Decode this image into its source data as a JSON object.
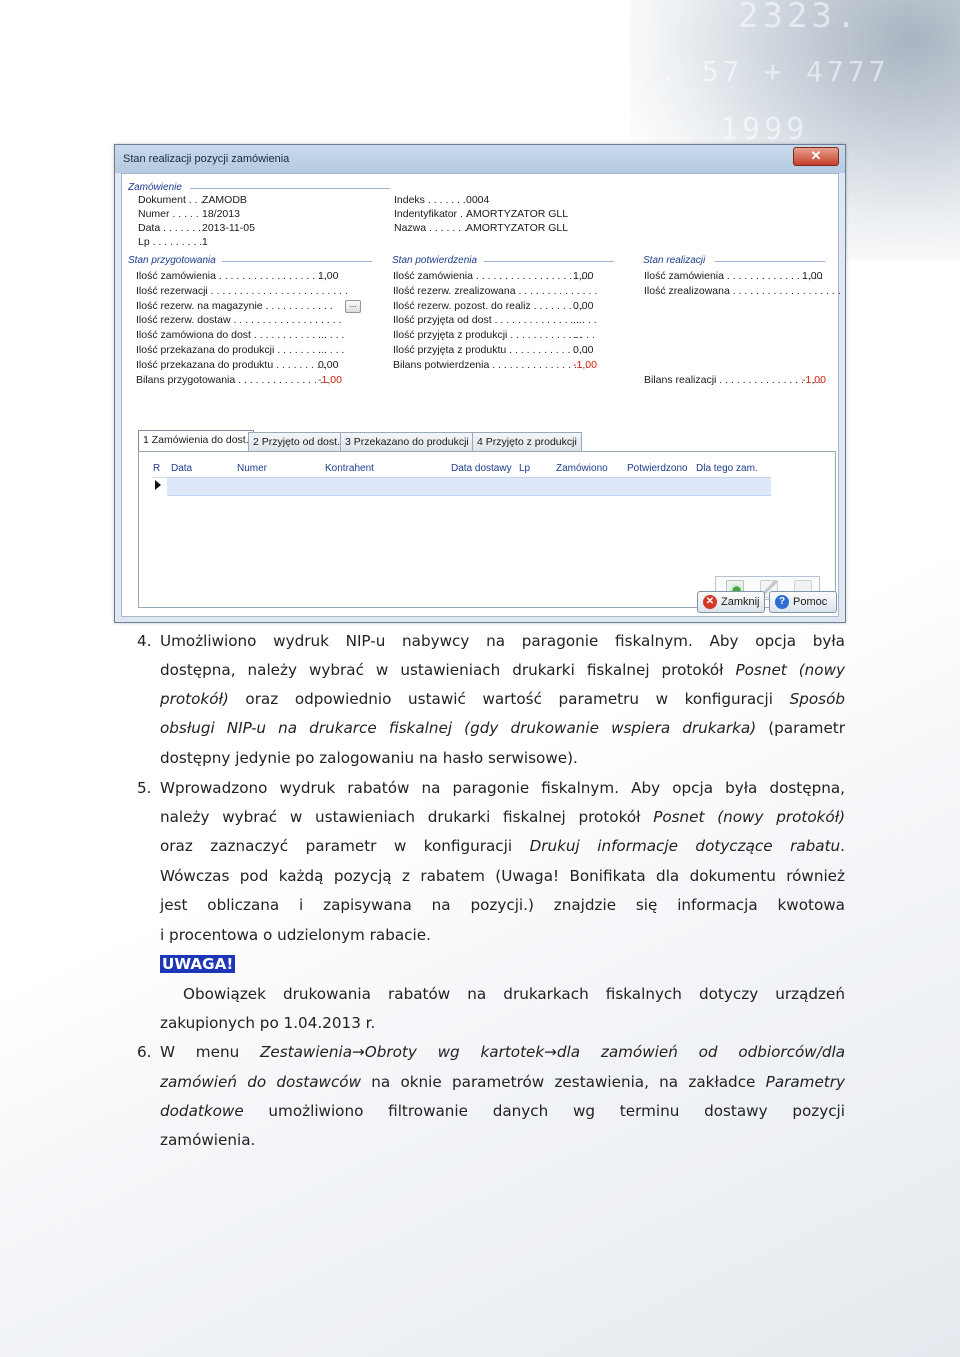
{
  "window": {
    "title": "Stan realizacji pozycji zamówienia",
    "close_glyph": "✕",
    "order": {
      "group_title": "Zamówienie",
      "rows": [
        {
          "label": "Dokument . . . ",
          "value": "ZAMODB"
        },
        {
          "label": "Numer . . . . . ",
          "value": "18/2013"
        },
        {
          "label": "Data . . . . . . . ",
          "value": "2013-11-05"
        },
        {
          "label": "Lp . . . . . . . . . ",
          "value": "1"
        }
      ]
    },
    "product": {
      "rows": [
        {
          "label": "Indeks . . . . . . . ",
          "value": "0004"
        },
        {
          "label": "Indentyfikator . . ",
          "value": "AMORTYZATOR GLL"
        },
        {
          "label": "Nazwa . . . . . . . ",
          "value": "AMORTYZATOR GLL"
        }
      ]
    },
    "prep": {
      "group_title": "Stan przygotowania",
      "rows": [
        {
          "label": "Ilość zamówienia . . . . . . . . . . . . . . . . . . . ",
          "value": "1,00",
          "neg": false
        },
        {
          "label": "Ilość rezerwacji . . . . . . . . . . . . . . . . . . . . . . . . ",
          "value": "",
          "neg": false
        },
        {
          "label": "Ilość rezerw. na magazynie . . . . . . . . . . . . ",
          "value": "",
          "neg": false
        },
        {
          "label": "Ilość rezerw. dostaw . . . . . . . . . . . . . . . . . . . ",
          "value": "",
          "neg": false
        },
        {
          "label": "Ilość zamówiona do dost . . . . . . . . . . . . . . . . ",
          "value": "...",
          "neg": false
        },
        {
          "label": "Ilość przekazana do produkcji . . . . . . . . . . . . ",
          "value": "...",
          "neg": false
        },
        {
          "label": "Ilość przekazana do produktu . . . . . . . . . ",
          "value": "0,00",
          "neg": false
        },
        {
          "label": "Bilans przygotowania . . . . . . . . . . . . . . . . ",
          "value": "-1,00",
          "neg": true
        }
      ]
    },
    "confirm": {
      "group_title": "Stan potwierdzenia",
      "rows": [
        {
          "label": "Ilość zamówienia . . . . . . . . . . . . . . . . . . . . ",
          "value": "1,00",
          "neg": false
        },
        {
          "label": "Ilość rezerw. zrealizowana . . . . . . . . . . . . . . ",
          "value": "",
          "neg": false
        },
        {
          "label": "Ilość rezerw. pozost. do realiz . . . . . . . . . ",
          "value": "0,00",
          "neg": false
        },
        {
          "label": "Ilość przyjęta od dost . . . . . . . . . . . . . . . . . . ",
          "value": "...",
          "neg": false
        },
        {
          "label": "Ilość przyjęta z produkcji . . . . . . . . . . . . . . . ",
          "value": "...",
          "neg": false
        },
        {
          "label": "Ilość przyjęta z produktu . . . . . . . . . . . . . . ",
          "value": "0,00",
          "neg": false
        },
        {
          "label": "Bilans potwierdzenia . . . . . . . . . . . . . . . . . ",
          "value": "-1,00",
          "neg": true
        }
      ]
    },
    "realization": {
      "group_title": "Stan realizacji",
      "rows": [
        {
          "label": "Ilość zamówienia . . . . . . . . . . . . . . . . . ",
          "value": "1,00",
          "neg": false
        },
        {
          "label": "Ilość zrealizowana . . . . . . . . . . . . . . . . . . . ",
          "value": "",
          "neg": false
        },
        {
          "label": "Bilans realizacji . . . . . . . . . . . . . . . . . . ",
          "value": "-1,00",
          "neg": true
        }
      ]
    },
    "tabs": [
      "1 Zamówienia do dost.",
      "2 Przyjęto od dost.",
      "3 Przekazano do produkcji",
      "4 Przyjęto z produkcji"
    ],
    "grid_columns": [
      "R",
      "Data",
      "Numer",
      "Kontrahent",
      "Data dostawy",
      "Lp",
      "Zamówiono",
      "Potwierdzono",
      "Dla tego zam."
    ],
    "buttons": {
      "close": "Zamknij",
      "help": "Pomoc"
    },
    "colors": {
      "title_accent": "#1e3d8f",
      "negative": "#d4200c",
      "selection": "#dde9fb"
    }
  },
  "text": {
    "item4": {
      "num": "4.",
      "l1": "Umożliwiono wydruk NIP-u nabywcy na paragonie fiskalnym. Aby opcja była",
      "l2a": "dostępna, należy wybrać w ustawieniach drukarki fiskalnej protokół ",
      "l2b": "Posnet (nowy",
      "l3a": "protokół)",
      "l3b": " oraz odpowiednio ustawić wartość parametru w konfiguracji ",
      "l3c": "Sposób",
      "l4a": "obsługi NIP-u na drukarce fiskalnej (gdy drukowanie wspiera drukarka)",
      "l4b": " (parametr",
      "l5": "dostępny jedynie po zalogowaniu na hasło serwisowe)."
    },
    "item5": {
      "num": "5.",
      "l1": "Wprowadzono wydruk rabatów na paragonie fiskalnym. Aby opcja była dostępna,",
      "l2a": "należy wybrać w ustawieniach drukarki fiskalnej protokół ",
      "l2b": "Posnet (nowy protokół)",
      "l3a": "oraz zaznaczyć parametr w konfiguracji ",
      "l3b": "Drukuj informacje dotyczące rabatu",
      "l3c": ".",
      "l4": "Wówczas pod każdą pozycją z rabatem (Uwaga! Bonifikata dla dokumentu również",
      "l5": "jest obliczana i zapisywana na pozycji.) znajdzie się informacja kwotowa",
      "l6": "i procentowa o udzielonym rabacie."
    },
    "uwaga": {
      "label": "UWAGA!",
      "l1": "Obowiązek drukowania rabatów na drukarkach fiskalnych dotyczy urządzeń",
      "l2": "zakupionych po 1.04.2013 r."
    },
    "item6": {
      "num": "6.",
      "l1a": "W menu ",
      "l1b": "Zestawienia",
      "arrow": "→",
      "l1c": "Obroty wg kartotek",
      "l1d": "dla zamówień od odbiorców/dla",
      "l2a": "zamówień do dostawców",
      "l2b": " na oknie parametrów zestawienia, na zakładce ",
      "l2c": "Parametry",
      "l3a": "dodatkowe",
      "l3b": " umożliwiono filtrowanie danych wg terminu dostawy pozycji",
      "l4": "zamówienia."
    }
  }
}
